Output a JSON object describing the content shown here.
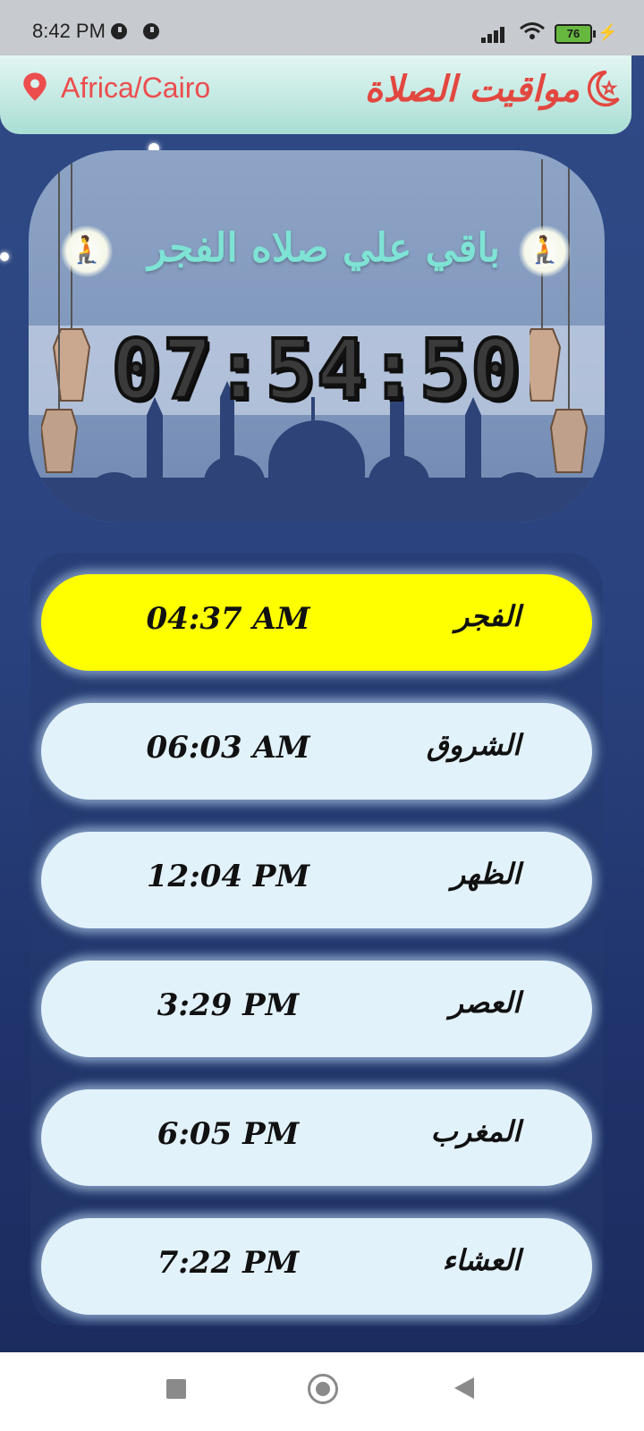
{
  "status_bar": {
    "time": "8:42 PM",
    "battery": "76"
  },
  "header": {
    "location": "Africa/Cairo",
    "title": "مواقيت الصلاة"
  },
  "hero": {
    "remaining_label": "باقي علي صلاه الفجر",
    "countdown": "07:54:50"
  },
  "prayers": [
    {
      "name": "الفجر",
      "time": "04:37 AM",
      "active": true
    },
    {
      "name": "الشروق",
      "time": "06:03 AM",
      "active": false
    },
    {
      "name": "الظهر",
      "time": "12:04 PM",
      "active": false
    },
    {
      "name": "العصر",
      "time": "3:29 PM",
      "active": false
    },
    {
      "name": "المغرب",
      "time": "6:05 PM",
      "active": false
    },
    {
      "name": "العشاء",
      "time": "7:22 PM",
      "active": false
    }
  ],
  "colors": {
    "active_row": "#ffff00",
    "row": "#e2f2fb",
    "accent_red": "#ec4d4d",
    "title_teal": "#7ee3d4"
  },
  "icons": [
    "location-pin-icon",
    "crescent-moon-icon",
    "praying-man-icon",
    "nav-recents-icon",
    "nav-home-icon",
    "nav-back-icon"
  ]
}
